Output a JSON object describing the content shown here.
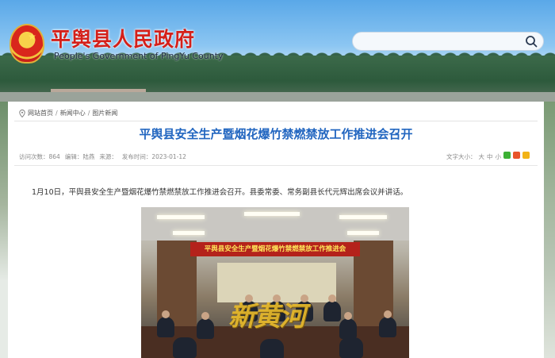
{
  "header": {
    "site_title": "平舆县人民政府",
    "site_subtitle": "People's Government of PingYu County",
    "search_placeholder": ""
  },
  "breadcrumb": {
    "items": [
      "网站首页",
      "新闻中心",
      "图片新闻"
    ],
    "separator": "/"
  },
  "article": {
    "title": "平舆县安全生产暨烟花爆竹禁燃禁放工作推进会召开",
    "meta": {
      "views_label": "访问次数：",
      "views": "864",
      "editor_label": "编辑：",
      "editor": "陆燕",
      "source_label": "来源：",
      "source": "",
      "date_label": "发布时间：",
      "date": "2023-01-12"
    },
    "font_size_label": "文字大小：",
    "font_sizes": [
      "大",
      "中",
      "小"
    ],
    "body": "1月10日，平舆县安全生产暨烟花爆竹禁燃禁放工作推进会召开。县委常委、常务副县长代元辉出席会议并讲话。",
    "photo_banner_text": "平舆县安全生产暨烟花爆竹禁燃禁放工作推进会",
    "watermark_text": "新黄河"
  },
  "colors": {
    "title_red": "#d4201a",
    "headline_blue": "#2266c0",
    "share_wechat": "#3cb034",
    "share_weibo": "#e8552a",
    "share_qzone": "#f2b316"
  }
}
